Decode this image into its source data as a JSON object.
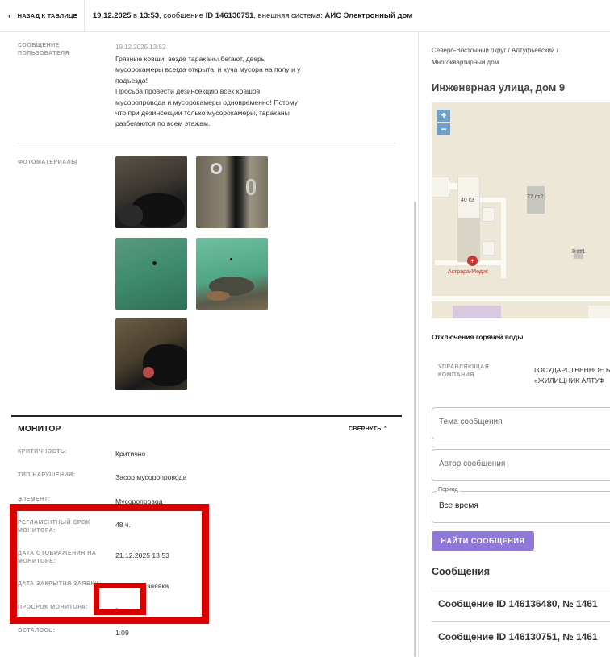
{
  "topbar": {
    "back_label": "НАЗАД К ТАБЛИЦЕ",
    "date_bold": "19.12.2025",
    "sep1": " в ",
    "time_bold": "13:53",
    "sep2": ", сообщение ",
    "id_bold": "ID 146130751",
    "sep3": ", внешняя система: ",
    "system_bold": "АИС Электронный дом"
  },
  "message": {
    "label": "СООБЩЕНИЕ ПОЛЬЗОВАТЕЛЯ",
    "date": "19.12.2025 13:52",
    "text": "Грязные ковши, везде тараканы бегают, дверь\nмусорокамеры всегда открыта, и куча мусора на полу и у\nподъезда!\nПросьба провести дезинсекцию всех ковшов\nмусоропровода и мусорокамеры одновременно! Потому\nчто при дезинсекции только мусорокамеры, тараканы\nразбегаются по всем этажам."
  },
  "photos": {
    "label": "ФОТОМАТЕРИАЛЫ"
  },
  "monitor": {
    "title": "МОНИТОР",
    "collapse": "СВЕРНУТЬ",
    "rows": [
      {
        "label": "КРИТИЧНОСТЬ:",
        "value": "Критично"
      },
      {
        "label": "ТИП НАРУШЕНИЯ:",
        "value": "Засор мусоропровода"
      },
      {
        "label": "ЭЛЕМЕНТ:",
        "value": "Мусоропровод"
      },
      {
        "label": "РЕГЛАМЕНТНЫЙ СРОК МОНИТОРА:",
        "value": "48 ч."
      },
      {
        "label": "ДАТА ОТОБРАЖЕНИЯ НА МОНИТОРЕ:",
        "value": "21.12.2025 13:53"
      },
      {
        "label": "ДАТА ЗАКРЫТИЯ ЗАЯВКИ:",
        "value": "Активная заявка"
      },
      {
        "label": "ПРОСРОК МОНИТОРА:",
        "value": "-"
      },
      {
        "label": "ОСТАЛОСЬ:",
        "value": "1:09"
      }
    ]
  },
  "right": {
    "location": "Северо-Восточный округ / Алтуфьевский / Многоквартирный дом",
    "address": "Инженерная улица, дом 9",
    "map": {
      "zoom_in": "+",
      "zoom_out": "−",
      "labels": {
        "b1": "40 к3",
        "b2": "27 ст2",
        "b3": "9 ст1",
        "poi": "Астрара-Медик"
      }
    },
    "hot_water": "Отключения горячей воды",
    "management_label": "УПРАВЛЯЮЩАЯ КОМПАНИЯ",
    "management_value_1": "ГОСУДАРСТВЕННОЕ Б",
    "management_value_2": "«ЖИЛИЩНИК АЛТУФ",
    "fields": {
      "topic_placeholder": "Тема сообщения",
      "author_placeholder": "Автор сообщения",
      "period_legend": "Период",
      "period_value": "Все время"
    },
    "find_button": "НАЙТИ СООБЩЕНИЯ",
    "messages_title": "Сообщения",
    "messages": [
      "Сообщение ID 146136480, № 1461",
      "Сообщение ID 146130751, № 1461"
    ]
  }
}
